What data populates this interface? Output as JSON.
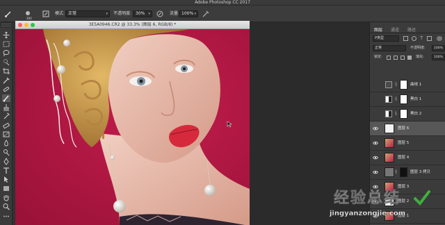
{
  "app": {
    "title": "Adobe Photoshop CC 2017"
  },
  "options": {
    "brush_size": "300",
    "mode_label": "模式:",
    "mode_value": "正常",
    "opacity_label": "不透明度:",
    "opacity_value": "30%",
    "flow_label": "流量:",
    "flow_value": "100%"
  },
  "document": {
    "title": "3E5A0946.CR2 @ 33.3% (图层 6, RGB/8) *"
  },
  "panel": {
    "tabs": [
      "图层",
      "通道",
      "路径"
    ],
    "filter_kind": "P类型",
    "blend_mode": "正常",
    "opacity_label": "不透明度:",
    "opacity_value": "100%",
    "lock_label": "锁定:",
    "fill_label": "填充:",
    "fill_value": "100%"
  },
  "layers": [
    {
      "name": "曲线 1",
      "kind": "adjustment",
      "visible": false,
      "selected": false
    },
    {
      "name": "黑白 1",
      "kind": "adjustment",
      "visible": false,
      "selected": false
    },
    {
      "name": "黑白 2",
      "kind": "adjustment",
      "visible": false,
      "selected": false
    },
    {
      "name": "图层 6",
      "kind": "pixel",
      "visible": true,
      "selected": true
    },
    {
      "name": "图层 5",
      "kind": "pixel",
      "visible": true,
      "selected": false
    },
    {
      "name": "图层 4",
      "kind": "pixel",
      "visible": true,
      "selected": false
    },
    {
      "name": "图层 3 拷贝",
      "kind": "masked",
      "visible": true,
      "selected": false
    },
    {
      "name": "图层 3",
      "kind": "pixel",
      "visible": true,
      "selected": false
    },
    {
      "name": "图层 2",
      "kind": "pixel",
      "visible": true,
      "selected": false
    },
    {
      "name": "图层 1",
      "kind": "pixel",
      "visible": true,
      "selected": false
    }
  ],
  "watermark": {
    "main": "经验总结",
    "url": "jingyanzongjie.com"
  },
  "colors": {
    "canvas_bg": "#b81b45",
    "selected_layer": "#575757",
    "panel_bg": "#3b3b3b"
  }
}
